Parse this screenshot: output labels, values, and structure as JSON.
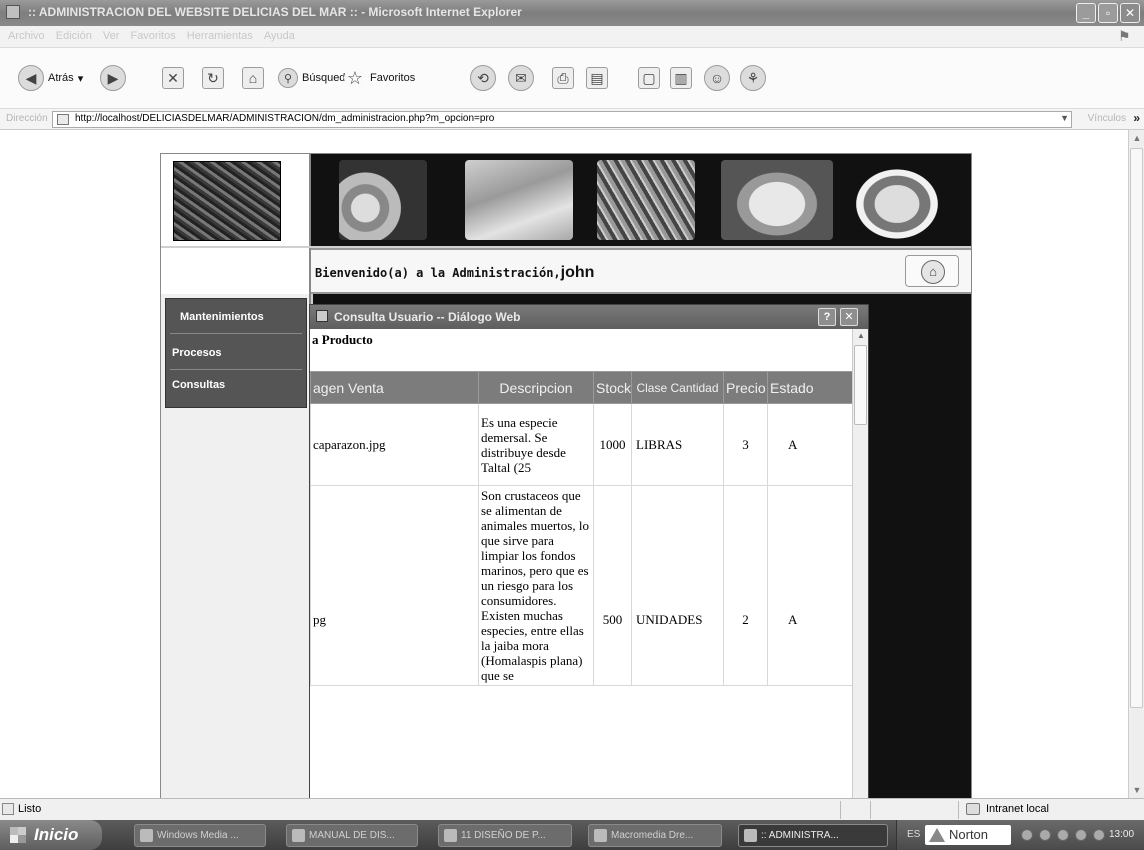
{
  "window": {
    "title": ":: ADMINISTRACION DEL WEBSITE DELICIAS DEL MAR :: - Microsoft Internet Explorer",
    "minimize": "_",
    "maximize": "▫",
    "close": "✕"
  },
  "menubar": {
    "items": [
      "Archivo",
      "Edición",
      "Ver",
      "Favoritos",
      "Herramientas",
      "Ayuda"
    ]
  },
  "toolbar": {
    "back_label": "Atrás",
    "search_label": "Búsqueda",
    "favorites_label": "Favoritos"
  },
  "address": {
    "label": "Dirección",
    "url": "http://localhost/DELICIASDELMAR/ADMINISTRACION/dm_administracion.php?m_opcion=pro",
    "links_label": "Vínculos",
    "links_more": "»"
  },
  "site": {
    "welcome_text": "Bienvenido(a) a la Administración,",
    "welcome_user": "john",
    "sidebar": {
      "items": [
        "Mantenimientos",
        "Procesos",
        "Consultas"
      ]
    }
  },
  "dialog": {
    "title": "Consulta Usuario -- Diálogo Web",
    "help": "?",
    "close": "✕",
    "heading": "a Producto",
    "columns": [
      "agen Venta",
      "Descripcion",
      "Stock",
      "Clase Cantidad",
      "Precio",
      "Estado"
    ],
    "rows": [
      {
        "image": "caparazon.jpg",
        "description": "Es una especie demersal. Se distribuye desde Taltal (25",
        "stock": "1000",
        "class": "LIBRAS",
        "price": "3",
        "status": "A"
      },
      {
        "image": "pg",
        "description": "Son crustaceos que se alimentan de animales muertos, lo que sirve para limpiar los fondos marinos, pero que es un riesgo para los consumidores. Existen muchas especies, entre ellas la jaiba mora (Homalaspis plana) que se",
        "stock": "500",
        "class": "UNIDADES",
        "price": "2",
        "status": "A"
      }
    ]
  },
  "statusbar": {
    "text": "Listo",
    "zone": "Intranet local"
  },
  "taskbar": {
    "start": "Inicio",
    "tasks": [
      "Windows Media ...",
      "MANUAL DE DIS...",
      "11 DISEÑO DE P...",
      "Macromedia Dre...",
      ":: ADMINISTRA..."
    ],
    "lang": "ES",
    "norton": "Norton",
    "clock": "13:00"
  }
}
